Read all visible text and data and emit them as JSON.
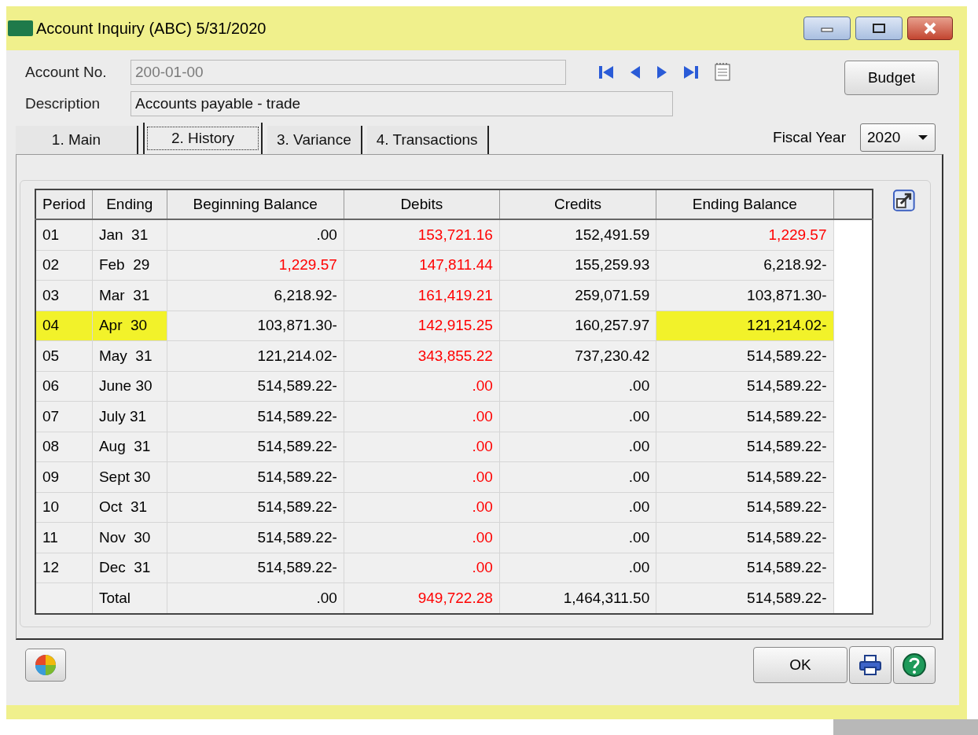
{
  "window": {
    "title": "Account Inquiry (ABC) 5/31/2020"
  },
  "form": {
    "account_label": "Account No.",
    "account_value": "200-01-00",
    "description_label": "Description",
    "description_value": "Accounts payable - trade",
    "budget_button": "Budget",
    "fiscal_year_label": "Fiscal Year",
    "fiscal_year_value": "2020"
  },
  "tabs": [
    {
      "label": "1. Main",
      "selected": false
    },
    {
      "label": "2. History",
      "selected": true
    },
    {
      "label": "3. Variance",
      "selected": false
    },
    {
      "label": "4. Transactions",
      "selected": false
    }
  ],
  "table": {
    "columns": [
      "Period",
      "Ending",
      "Beginning Balance",
      "Debits",
      "Credits",
      "Ending Balance"
    ],
    "rows": [
      {
        "cells": [
          {
            "text": "01",
            "color": "#000000",
            "highlighted": false
          },
          {
            "text": "Jan  31",
            "color": "#000000",
            "highlighted": false
          },
          {
            "text": ".00",
            "color": "#000000",
            "highlighted": false
          },
          {
            "text": "153,721.16",
            "color": "#ff0000",
            "highlighted": false
          },
          {
            "text": "152,491.59",
            "color": "#000000",
            "highlighted": false
          },
          {
            "text": "1,229.57",
            "color": "#ff0000",
            "highlighted": false
          }
        ]
      },
      {
        "cells": [
          {
            "text": "02",
            "color": "#000000",
            "highlighted": false
          },
          {
            "text": "Feb  29",
            "color": "#000000",
            "highlighted": false
          },
          {
            "text": "1,229.57",
            "color": "#ff0000",
            "highlighted": false
          },
          {
            "text": "147,811.44",
            "color": "#ff0000",
            "highlighted": false
          },
          {
            "text": "155,259.93",
            "color": "#000000",
            "highlighted": false
          },
          {
            "text": "6,218.92-",
            "color": "#000000",
            "highlighted": false
          }
        ]
      },
      {
        "cells": [
          {
            "text": "03",
            "color": "#000000",
            "highlighted": false
          },
          {
            "text": "Mar  31",
            "color": "#000000",
            "highlighted": false
          },
          {
            "text": "6,218.92-",
            "color": "#000000",
            "highlighted": false
          },
          {
            "text": "161,419.21",
            "color": "#ff0000",
            "highlighted": false
          },
          {
            "text": "259,071.59",
            "color": "#000000",
            "highlighted": false
          },
          {
            "text": "103,871.30-",
            "color": "#000000",
            "highlighted": false
          }
        ]
      },
      {
        "cells": [
          {
            "text": "04",
            "color": "#000000",
            "highlighted": true
          },
          {
            "text": "Apr  30",
            "color": "#000000",
            "highlighted": true
          },
          {
            "text": "103,871.30-",
            "color": "#000000",
            "highlighted": false
          },
          {
            "text": "142,915.25",
            "color": "#ff0000",
            "highlighted": false
          },
          {
            "text": "160,257.97",
            "color": "#000000",
            "highlighted": false
          },
          {
            "text": "121,214.02-",
            "color": "#000000",
            "highlighted": true
          }
        ]
      },
      {
        "cells": [
          {
            "text": "05",
            "color": "#000000",
            "highlighted": false
          },
          {
            "text": "May  31",
            "color": "#000000",
            "highlighted": false
          },
          {
            "text": "121,214.02-",
            "color": "#000000",
            "highlighted": false
          },
          {
            "text": "343,855.22",
            "color": "#ff0000",
            "highlighted": false
          },
          {
            "text": "737,230.42",
            "color": "#000000",
            "highlighted": false
          },
          {
            "text": "514,589.22-",
            "color": "#000000",
            "highlighted": false
          }
        ]
      },
      {
        "cells": [
          {
            "text": "06",
            "color": "#000000",
            "highlighted": false
          },
          {
            "text": "June 30",
            "color": "#000000",
            "highlighted": false
          },
          {
            "text": "514,589.22-",
            "color": "#000000",
            "highlighted": false
          },
          {
            "text": ".00",
            "color": "#ff0000",
            "highlighted": false
          },
          {
            "text": ".00",
            "color": "#000000",
            "highlighted": false
          },
          {
            "text": "514,589.22-",
            "color": "#000000",
            "highlighted": false
          }
        ]
      },
      {
        "cells": [
          {
            "text": "07",
            "color": "#000000",
            "highlighted": false
          },
          {
            "text": "July 31",
            "color": "#000000",
            "highlighted": false
          },
          {
            "text": "514,589.22-",
            "color": "#000000",
            "highlighted": false
          },
          {
            "text": ".00",
            "color": "#ff0000",
            "highlighted": false
          },
          {
            "text": ".00",
            "color": "#000000",
            "highlighted": false
          },
          {
            "text": "514,589.22-",
            "color": "#000000",
            "highlighted": false
          }
        ]
      },
      {
        "cells": [
          {
            "text": "08",
            "color": "#000000",
            "highlighted": false
          },
          {
            "text": "Aug  31",
            "color": "#000000",
            "highlighted": false
          },
          {
            "text": "514,589.22-",
            "color": "#000000",
            "highlighted": false
          },
          {
            "text": ".00",
            "color": "#ff0000",
            "highlighted": false
          },
          {
            "text": ".00",
            "color": "#000000",
            "highlighted": false
          },
          {
            "text": "514,589.22-",
            "color": "#000000",
            "highlighted": false
          }
        ]
      },
      {
        "cells": [
          {
            "text": "09",
            "color": "#000000",
            "highlighted": false
          },
          {
            "text": "Sept 30",
            "color": "#000000",
            "highlighted": false
          },
          {
            "text": "514,589.22-",
            "color": "#000000",
            "highlighted": false
          },
          {
            "text": ".00",
            "color": "#ff0000",
            "highlighted": false
          },
          {
            "text": ".00",
            "color": "#000000",
            "highlighted": false
          },
          {
            "text": "514,589.22-",
            "color": "#000000",
            "highlighted": false
          }
        ]
      },
      {
        "cells": [
          {
            "text": "10",
            "color": "#000000",
            "highlighted": false
          },
          {
            "text": "Oct  31",
            "color": "#000000",
            "highlighted": false
          },
          {
            "text": "514,589.22-",
            "color": "#000000",
            "highlighted": false
          },
          {
            "text": ".00",
            "color": "#ff0000",
            "highlighted": false
          },
          {
            "text": ".00",
            "color": "#000000",
            "highlighted": false
          },
          {
            "text": "514,589.22-",
            "color": "#000000",
            "highlighted": false
          }
        ]
      },
      {
        "cells": [
          {
            "text": "11",
            "color": "#000000",
            "highlighted": false
          },
          {
            "text": "Nov  30",
            "color": "#000000",
            "highlighted": false
          },
          {
            "text": "514,589.22-",
            "color": "#000000",
            "highlighted": false
          },
          {
            "text": ".00",
            "color": "#ff0000",
            "highlighted": false
          },
          {
            "text": ".00",
            "color": "#000000",
            "highlighted": false
          },
          {
            "text": "514,589.22-",
            "color": "#000000",
            "highlighted": false
          }
        ]
      },
      {
        "cells": [
          {
            "text": "12",
            "color": "#000000",
            "highlighted": false
          },
          {
            "text": "Dec  31",
            "color": "#000000",
            "highlighted": false
          },
          {
            "text": "514,589.22-",
            "color": "#000000",
            "highlighted": false
          },
          {
            "text": ".00",
            "color": "#ff0000",
            "highlighted": false
          },
          {
            "text": ".00",
            "color": "#000000",
            "highlighted": false
          },
          {
            "text": "514,589.22-",
            "color": "#000000",
            "highlighted": false
          }
        ]
      },
      {
        "cells": [
          {
            "text": ""
          },
          {
            "text": "Total",
            "color": "#000000",
            "highlighted": false
          },
          {
            "text": ".00",
            "color": "#000000",
            "highlighted": false
          },
          {
            "text": "949,722.28",
            "color": "#ff0000",
            "highlighted": false
          },
          {
            "text": "1,464,311.50",
            "color": "#000000",
            "highlighted": false
          },
          {
            "text": "514,589.22-",
            "color": "#000000",
            "highlighted": false
          }
        ]
      }
    ]
  },
  "footer": {
    "ok_button": "OK"
  }
}
